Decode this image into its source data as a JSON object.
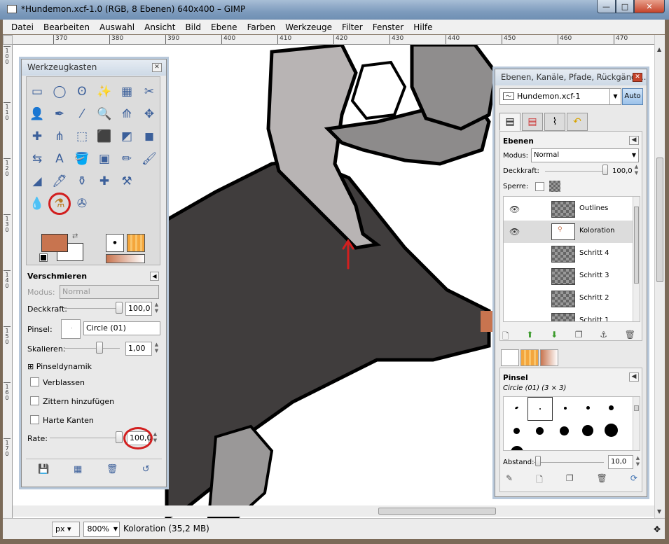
{
  "window": {
    "title": "*Hundemon.xcf-1.0 (RGB, 8 Ebenen) 640x400 – GIMP",
    "min": "—",
    "max": "□",
    "close": "✕"
  },
  "menu": [
    "Datei",
    "Bearbeiten",
    "Auswahl",
    "Ansicht",
    "Bild",
    "Ebene",
    "Farben",
    "Werkzeuge",
    "Filter",
    "Fenster",
    "Hilfe"
  ],
  "ruler_h": [
    "370",
    "380",
    "390",
    "400",
    "410",
    "420",
    "430",
    "440",
    "450",
    "460",
    "470"
  ],
  "ruler_v": [
    "1 0 0",
    "1 1 0",
    "1 2 0",
    "1 3 0",
    "1 4 0",
    "1 5 0",
    "1 6 0",
    "1 7 0"
  ],
  "statusbar": {
    "unit": "px",
    "zoom": "800%",
    "text": "Koloration (35,2 MB)"
  },
  "toolbox": {
    "title": "Werkzeugkasten",
    "tools": [
      "▭",
      "◯",
      "ʘ",
      "✨",
      "▦",
      "✂",
      "👤",
      "✒",
      "⁄",
      "🔍",
      "⟰",
      "✥",
      "✚",
      "⋔",
      "⬚",
      "⬛",
      "◩",
      "◼",
      "⇆",
      "A",
      "🪣",
      "▣",
      "✏",
      "🖌",
      "◢",
      "🖊",
      "⚱",
      "✚",
      "⚒",
      "",
      "💧",
      "⚗",
      "✇",
      "",
      "",
      ""
    ],
    "selected_tool_index": 31,
    "options_title": "Verschmieren",
    "modus_label": "Modus:",
    "modus_value": "Normal",
    "deckkraft_label": "Deckkraft:",
    "deckkraft_value": "100,0",
    "pinsel_label": "Pinsel:",
    "pinsel_value": "Circle (01)",
    "skalieren_label": "Skalieren:",
    "skalieren_value": "1,00",
    "pinseldynamik": "Pinseldynamik",
    "verblassen": "Verblassen",
    "zittern": "Zittern hinzufügen",
    "harte_kanten": "Harte Kanten",
    "rate_label": "Rate:",
    "rate_value": "100,0"
  },
  "dock": {
    "title": "Ebenen, Kanäle, Pfade, Rückgängi...",
    "image": "Hundemon.xcf-1",
    "auto": "Auto",
    "ebenen_title": "Ebenen",
    "modus_label": "Modus:",
    "modus_value": "Normal",
    "deckkraft_label": "Deckkraft:",
    "deckkraft_value": "100,0",
    "sperre_label": "Sperre:",
    "layers": [
      {
        "name": "Outlines",
        "visible": true,
        "selected": false
      },
      {
        "name": "Koloration",
        "visible": true,
        "selected": true
      },
      {
        "name": "Schritt 4",
        "visible": false,
        "selected": false
      },
      {
        "name": "Schritt 3",
        "visible": false,
        "selected": false
      },
      {
        "name": "Schritt 2",
        "visible": false,
        "selected": false
      },
      {
        "name": "Schritt 1",
        "visible": false,
        "selected": false
      }
    ],
    "pinsel_title": "Pinsel",
    "pinsel_current": "Circle (01) (3 × 3)",
    "abstand_label": "Abstand:",
    "abstand_value": "10,0"
  },
  "colors": {
    "foreground": "#c8744f",
    "background": "#ffffff",
    "annotation": "#d21f1f"
  }
}
